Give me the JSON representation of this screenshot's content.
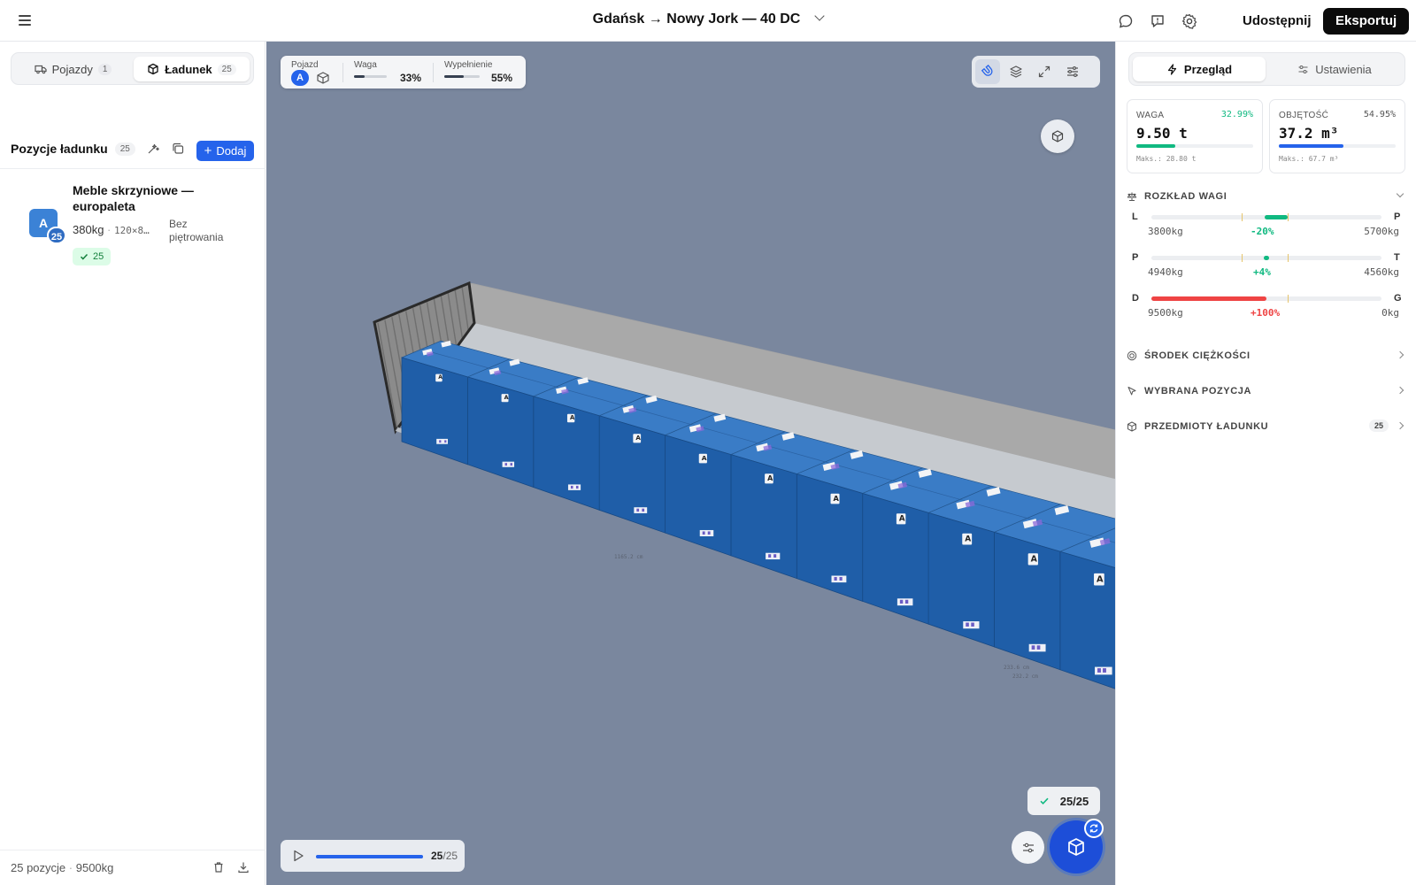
{
  "header": {
    "title": "Gdańsk → Nowy Jork — 40 DC",
    "share_label": "Udostępnij",
    "export_label": "Eksportuj"
  },
  "left": {
    "tabs": [
      {
        "label": "Pojazdy",
        "count": "1",
        "icon": "truck-icon"
      },
      {
        "label": "Ładunek",
        "count": "25",
        "icon": "box-icon"
      }
    ],
    "section_title": "Pozycje ładunku",
    "section_count": "25",
    "add_label": "Dodaj",
    "items": [
      {
        "badge": "A",
        "badge_count": "25",
        "name": "Meble skrzyniowe — europaleta",
        "weight": "380kg",
        "dims": "120×8…",
        "stacking": "Bez piętrowania",
        "placed": "25"
      }
    ],
    "footer_count": "25 pozycje",
    "footer_weight": "9500kg"
  },
  "viewport": {
    "hud": {
      "vehicle_label": "Pojazd",
      "vehicle_badge": "A",
      "weight_label": "Waga",
      "weight_pct": "33%",
      "weight_fill": 0.33,
      "fill_label": "Wypełnienie",
      "fill_pct": "55%",
      "fill_fill": 0.55
    },
    "dim_label": "1165.2 cm",
    "side_labels": [
      "233.6 cm",
      "232.2 cm"
    ],
    "done_chip": "25/25",
    "player": {
      "current": "25",
      "total": "/25",
      "progress": 1.0
    },
    "background": "#7a879e",
    "box_color": "#2f6fb8"
  },
  "right": {
    "tabs": [
      {
        "label": "Przegląd",
        "icon": "bolt-icon"
      },
      {
        "label": "Ustawienia",
        "icon": "sliders-icon"
      }
    ],
    "cards": {
      "weight": {
        "label": "WAGA",
        "pct": "32.99%",
        "value": "9.50 t",
        "max": "Maks.: 28.80 t",
        "fill": 0.33,
        "color": "#10b981"
      },
      "volume": {
        "label": "OBJĘTOŚĆ",
        "pct": "54.95%",
        "value": "37.2 m³",
        "max": "Maks.: 67.7 m³",
        "fill": 0.55,
        "color": "#2563eb"
      }
    },
    "weight_dist": {
      "title": "ROZKŁAD WAGI",
      "rows": [
        {
          "left": "L",
          "right": "P",
          "v1": "3800kg",
          "v2": "-20%",
          "v3": "5700kg",
          "color": "#10b981"
        },
        {
          "left": "P",
          "right": "T",
          "v1": "4940kg",
          "v2": "+4%",
          "v3": "4560kg",
          "color": "#10b981"
        },
        {
          "left": "D",
          "right": "G",
          "v1": "9500kg",
          "v2": "+100%",
          "v3": "0kg",
          "color": "#ef4444"
        }
      ]
    },
    "sections": {
      "cog": "ŚRODEK CIĘŻKOŚCI",
      "selected": "WYBRANA POZYCJA",
      "items": "PRZEDMIOTY ŁADUNKU",
      "items_count": "25"
    }
  }
}
